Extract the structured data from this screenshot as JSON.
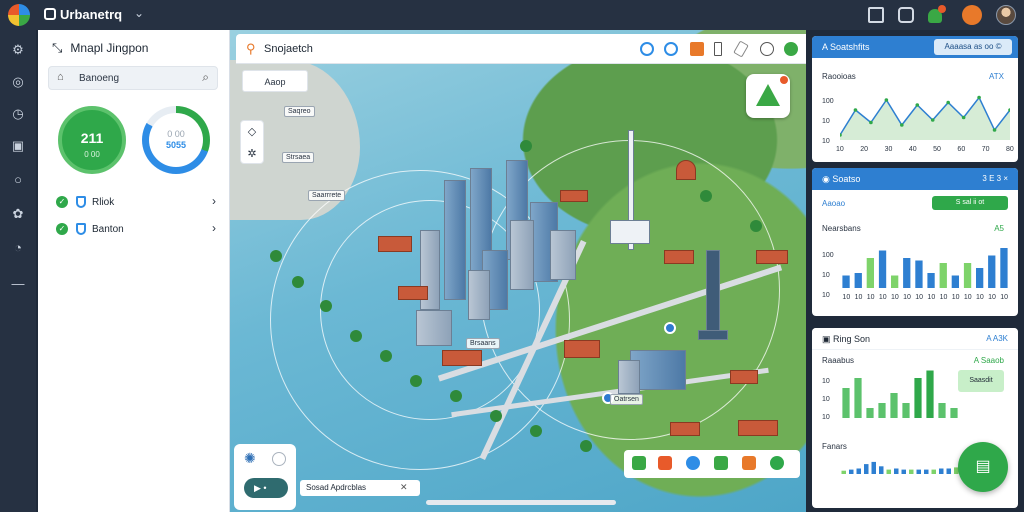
{
  "app": {
    "title": "Urbanetrq",
    "logo_icon": "globe-logo-icon"
  },
  "topbar": {
    "notification_badge": ""
  },
  "left_panel": {
    "title": "Mnapl Jingpon",
    "search_value": "Banoeng",
    "stat_primary_value": "211",
    "stat_primary_caption": "0 00",
    "stat_secondary_caption": "0 00",
    "stat_secondary_value": "5055",
    "items": [
      {
        "label": "Rliok"
      },
      {
        "label": "Banton"
      }
    ]
  },
  "map": {
    "search_text": "Snojaetch",
    "chip_label": "Aaop",
    "labels": [
      "Saqreo",
      "Strsaea",
      "Saarrrete",
      "Brsaans",
      "Oatrsen"
    ],
    "status_text": "Sosad Apdrcblas"
  },
  "panels": {
    "p1": {
      "title": "A Soatshfits",
      "pill": "Aaaasa as oo ©",
      "sub_left": "Raooioas",
      "sub_right": "ATX"
    },
    "p2": {
      "title": "Soatso",
      "right": "3 E 3   ×",
      "sub_left": "Aaoao",
      "pill": "S sal ii ot",
      "sub_right": "A5",
      "legend_left": "Nearsbans"
    },
    "p3": {
      "title": "Ring Son",
      "right": "A  A3K",
      "sub_left": "Raaabus",
      "sub_right": "A Saaob",
      "footer_left": "Fanars",
      "badge": "Saasdit"
    }
  },
  "chart_data": [
    {
      "type": "line",
      "title": "A Soatshfits",
      "categories": [
        "10",
        "20",
        "30",
        "40",
        "50",
        "60",
        "70",
        "80"
      ],
      "yticks": [
        "100",
        "10",
        "10"
      ],
      "series": [
        {
          "name": "",
          "values": [
            10,
            60,
            35,
            80,
            30,
            70,
            40,
            75,
            45,
            85,
            20,
            60
          ]
        }
      ]
    },
    {
      "type": "bar",
      "title": "Soatso",
      "categories": [
        "10",
        "10",
        "10",
        "10",
        "10",
        "10",
        "10",
        "10",
        "10",
        "10",
        "10",
        "10",
        "10",
        "10"
      ],
      "yticks": [
        "100",
        "10",
        "10"
      ],
      "series": [
        {
          "name": "",
          "values": [
            25,
            30,
            60,
            75,
            25,
            60,
            55,
            30,
            50,
            25,
            50,
            40,
            65,
            80
          ]
        }
      ]
    },
    {
      "type": "bar",
      "title": "Ring Son",
      "categories": [
        "",
        "",
        "",
        "",
        "",
        "",
        "",
        "",
        "",
        ""
      ],
      "yticks": [
        "10",
        "10",
        "10"
      ],
      "series": [
        {
          "name": "",
          "values": [
            60,
            80,
            20,
            30,
            50,
            30,
            80,
            95,
            30,
            20
          ]
        }
      ]
    },
    {
      "type": "bar",
      "title": "Ring Son",
      "categories": [
        "",
        "",
        "",
        "",
        "",
        "",
        "",
        "",
        "",
        "",
        "",
        "",
        "",
        "",
        "",
        ""
      ],
      "yticks": [],
      "series": [
        {
          "name": "",
          "values": [
            15,
            20,
            25,
            45,
            55,
            35,
            20,
            25,
            20,
            20,
            20,
            20,
            20,
            25,
            25,
            30
          ]
        }
      ]
    }
  ],
  "colors": {
    "accent_blue": "#2e7fd1",
    "accent_green": "#2fa84a",
    "bar_light_green": "#7ed36a"
  }
}
